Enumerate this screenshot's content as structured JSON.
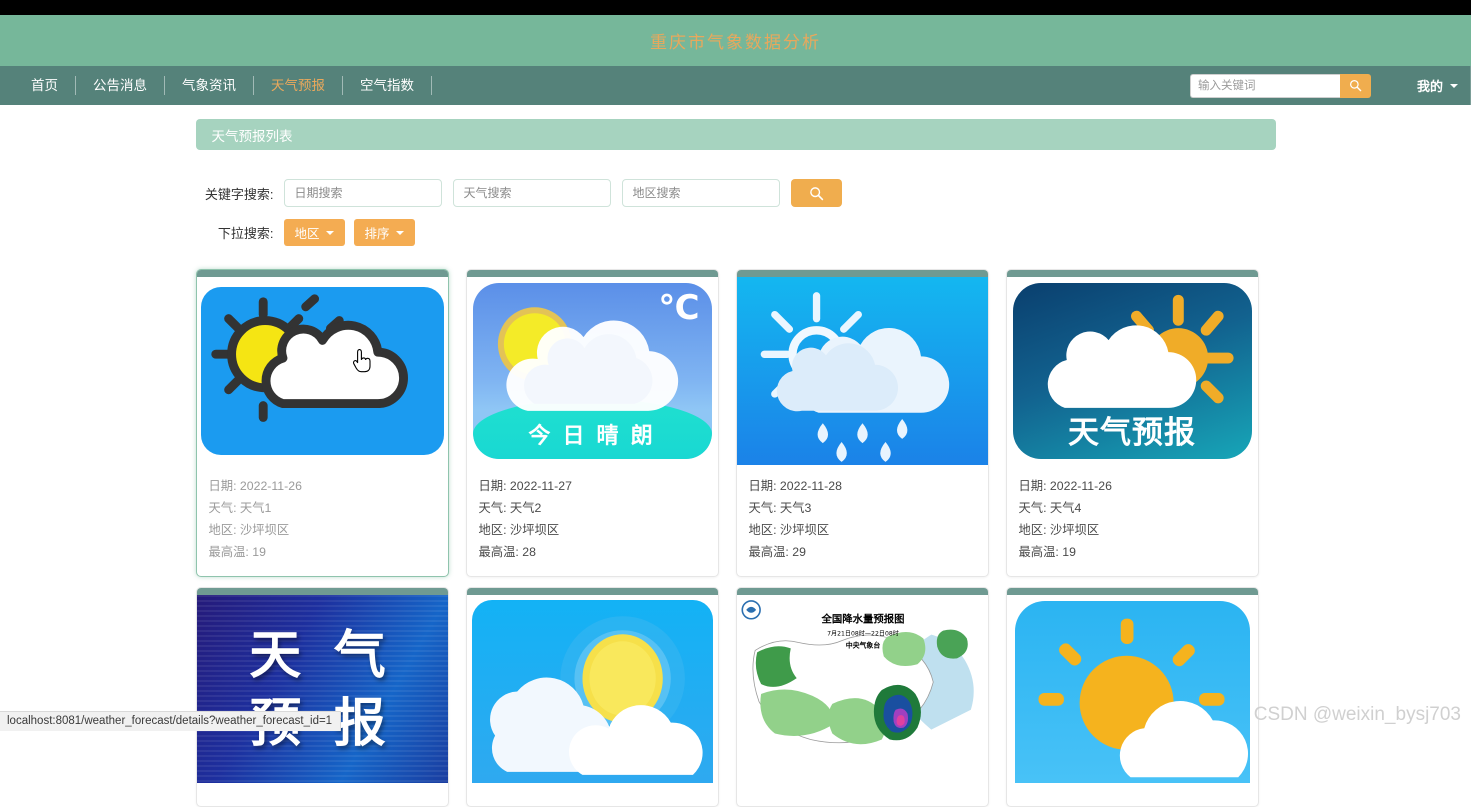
{
  "banner": {
    "title": "重庆市气象数据分析"
  },
  "nav": {
    "items": [
      {
        "label": "首页",
        "active": false
      },
      {
        "label": "公告消息",
        "active": false
      },
      {
        "label": "气象资讯",
        "active": false
      },
      {
        "label": "天气预报",
        "active": true
      },
      {
        "label": "空气指数",
        "active": false
      }
    ],
    "search": {
      "placeholder": "输入关键词",
      "value": "",
      "icon": "search-icon"
    },
    "account": {
      "label": "我的",
      "icon": "chevron-down-icon"
    }
  },
  "panel": {
    "title": "天气预报列表"
  },
  "filters": {
    "keyword_label": "关键字搜索:",
    "date_placeholder": "日期搜索",
    "weather_placeholder": "天气搜索",
    "region_placeholder": "地区搜索",
    "search_icon": "search-icon",
    "dropdown_label": "下拉搜索:",
    "dropdowns": [
      {
        "label": "地区",
        "icon": "chevron-down-icon"
      },
      {
        "label": "排序",
        "icon": "chevron-down-icon"
      }
    ]
  },
  "card_fields": {
    "date": "日期",
    "weather": "天气",
    "region": "地区",
    "max_temp": "最高温"
  },
  "cards": [
    {
      "id": 1,
      "date": "日期: 2022-11-26",
      "weather": "天气: 天气1",
      "region": "地区: 沙坪坝区",
      "max_temp": "最高温: 19",
      "art": "sun-cloud-flat",
      "hovered": true
    },
    {
      "id": 2,
      "date": "日期: 2022-11-27",
      "weather": "天气: 天气2",
      "region": "地区: 沙坪坝区",
      "max_temp": "最高温: 28",
      "art": "sunny-today",
      "caption": "今 日 晴 朗",
      "badge": "℃",
      "hovered": false
    },
    {
      "id": 3,
      "date": "日期: 2022-11-28",
      "weather": "天气: 天气3",
      "region": "地区: 沙坪坝区",
      "max_temp": "最高温: 29",
      "art": "sun-cloud-rain",
      "hovered": false
    },
    {
      "id": 4,
      "date": "日期: 2022-11-26",
      "weather": "天气: 天气4",
      "region": "地区: 沙坪坝区",
      "max_temp": "最高温: 19",
      "art": "forecast-logo",
      "caption": "天气预报",
      "hovered": false
    },
    {
      "id": 5,
      "art": "tv-forecast",
      "caption": "天 气",
      "caption2": "预 报",
      "hovered": false
    },
    {
      "id": 6,
      "art": "sun-behind-clouds",
      "hovered": false
    },
    {
      "id": 7,
      "art": "rainfall-map",
      "map_title": "全国降水量预报图",
      "map_sub": "7月21日08时—22日08时",
      "map_org": "中央气象台",
      "hovered": false
    },
    {
      "id": 8,
      "art": "big-sun-cloud",
      "hovered": false
    }
  ],
  "statusbar": {
    "url": "localhost:8081/weather_forecast/details?weather_forecast_id=1"
  },
  "watermark": {
    "text": "CSDN @weixin_bysj703"
  },
  "colors": {
    "banner_bg": "#76b79a",
    "nav_bg": "#55827a",
    "accent_orange": "#f0ad4e",
    "panel_head_bg": "#a6d3bf",
    "card_strip": "#6f9a92"
  }
}
